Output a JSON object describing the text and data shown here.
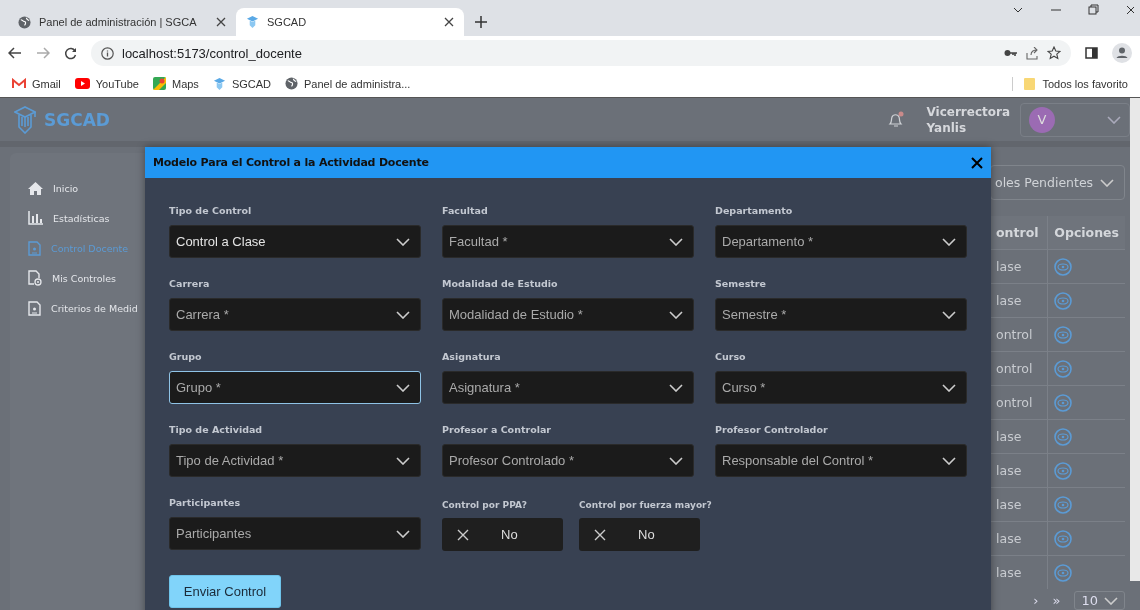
{
  "browser": {
    "tabs": [
      {
        "title": "Panel de administración | SGCA",
        "selected": false
      },
      {
        "title": "SGCAD",
        "selected": true
      }
    ],
    "address": "localhost:5173/control_docente",
    "bookmarks": [
      "Gmail",
      "YouTube",
      "Maps",
      "SGCAD",
      "Panel de administra..."
    ],
    "all_bookmarks": "Todos los favorito"
  },
  "app": {
    "brand": "SGCAD",
    "user": {
      "role": "Vicerrectora",
      "name": "Yanlis",
      "initial": "V"
    },
    "sidebar": {
      "items": [
        {
          "label": "Inicio",
          "selected": false
        },
        {
          "label": "Estadísticas",
          "selected": false
        },
        {
          "label": "Control Docente",
          "selected": true
        },
        {
          "label": "Mis Controles",
          "selected": false
        },
        {
          "label": "Criterios de Medid",
          "selected": false
        }
      ]
    },
    "filter": {
      "value": "oles Pendientes"
    },
    "table": {
      "columns": [
        "ontrol",
        "Opciones"
      ],
      "rows": [
        {
          "column_1": "lase"
        },
        {
          "column_1": "lase"
        },
        {
          "column_1": "ontrol"
        },
        {
          "column_1": "ontrol"
        },
        {
          "column_1": "ontrol"
        },
        {
          "column_1": "lase"
        },
        {
          "column_1": "lase"
        },
        {
          "column_1": "lase"
        },
        {
          "column_1": "lase"
        },
        {
          "column_1": "lase"
        }
      ]
    },
    "pagination": {
      "next": "›",
      "last": "»",
      "page_size": "10"
    }
  },
  "modal": {
    "title": "Modelo Para el Control a la Actividad Docente",
    "fields": [
      {
        "label": "Tipo de Control",
        "value": "Control a Clase",
        "focused": false
      },
      {
        "label": "Facultad",
        "placeholder": "Facultad *",
        "focused": false
      },
      {
        "label": "Departamento",
        "placeholder": "Departamento *",
        "focused": false
      },
      {
        "label": "Carrera",
        "placeholder": "Carrera *",
        "focused": false
      },
      {
        "label": "Modalidad de Estudio",
        "placeholder": "Modalidad de Estudio *",
        "focused": false
      },
      {
        "label": "Semestre",
        "placeholder": "Semestre *",
        "focused": false
      },
      {
        "label": "Grupo",
        "placeholder": "Grupo *",
        "focused": true
      },
      {
        "label": "Asignatura",
        "placeholder": "Asignatura *",
        "focused": false
      },
      {
        "label": "Curso",
        "placeholder": "Curso *",
        "focused": false
      },
      {
        "label": "Tipo de Actividad",
        "placeholder": "Tipo de Actividad *",
        "focused": false
      },
      {
        "label": "Profesor a Controlar",
        "placeholder": "Profesor Controlado *",
        "focused": false
      },
      {
        "label": "Profesor Controlador",
        "placeholder": "Responsable del Control *",
        "focused": false
      },
      {
        "label": "Participantes",
        "placeholder": "Participantes",
        "focused": false
      }
    ],
    "switches": [
      {
        "label": "Control por PPA?",
        "value": "No",
        "on": false
      },
      {
        "label": "Control por fuerza mayor?",
        "value": "No",
        "on": false
      }
    ],
    "submit": "Enviar Control"
  }
}
